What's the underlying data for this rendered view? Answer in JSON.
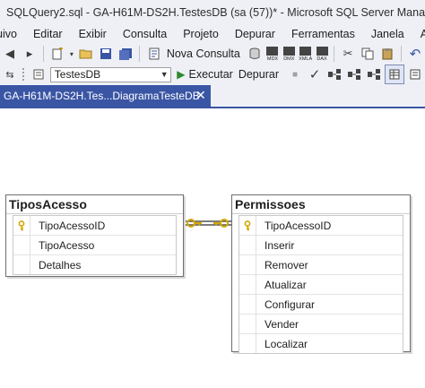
{
  "window": {
    "title": "SQLQuery2.sql - GA-H61M-DS2H.TestesDB (sa (57))* - Microsoft SQL Server Management Studio"
  },
  "menu": [
    "uivo",
    "Editar",
    "Exibir",
    "Consulta",
    "Projeto",
    "Depurar",
    "Ferramentas",
    "Janela",
    "Ajuda"
  ],
  "toolbar": {
    "database_selected": "TestesDB",
    "execute_label": "Executar",
    "debug_label": "Depurar",
    "new_query_label": "Nova Consulta",
    "mini_buttons": [
      "MDX",
      "DMX",
      "XMLA",
      "DAX"
    ]
  },
  "tab": {
    "label": "GA-H61M-DS2H.Tes...DiagramaTesteDB",
    "close_glyph": "✕"
  },
  "diagram": {
    "tables": [
      {
        "name": "TiposAcesso",
        "columns": [
          {
            "name": "TipoAcessoID",
            "primary_key": true
          },
          {
            "name": "TipoAcesso",
            "primary_key": false
          },
          {
            "name": "Detalhes",
            "primary_key": false
          }
        ]
      },
      {
        "name": "Permissoes",
        "columns": [
          {
            "name": "TipoAcessoID",
            "primary_key": true
          },
          {
            "name": "Inserir",
            "primary_key": false
          },
          {
            "name": "Remover",
            "primary_key": false
          },
          {
            "name": "Atualizar",
            "primary_key": false
          },
          {
            "name": "Configurar",
            "primary_key": false
          },
          {
            "name": "Vender",
            "primary_key": false
          },
          {
            "name": "Localizar",
            "primary_key": false
          }
        ]
      }
    ],
    "relationship": {
      "from": "TiposAcesso",
      "to": "Permissoes",
      "type": "one-to-one",
      "key_color": "#d4a800"
    }
  },
  "colors": {
    "chrome": "#eef0f6",
    "tab_active": "#3a55a4",
    "execute_green": "#2a8a2a"
  }
}
